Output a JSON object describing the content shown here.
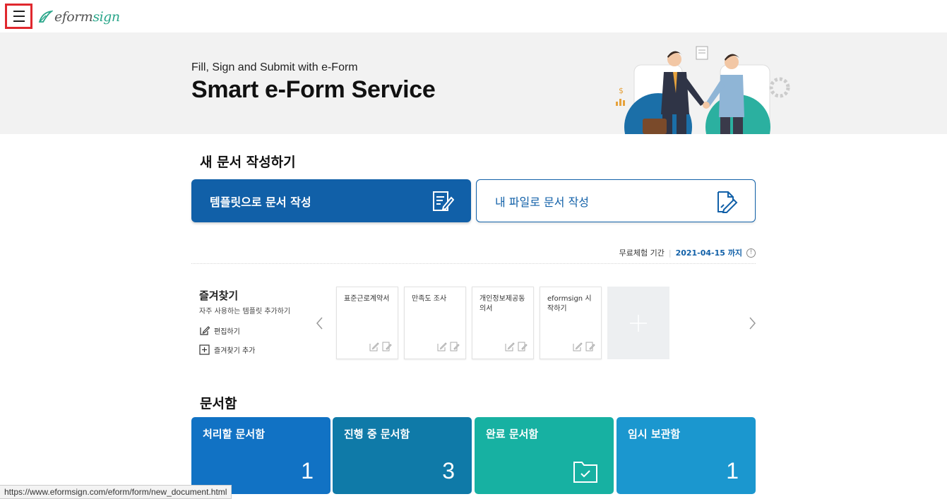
{
  "header": {
    "menu_icon": "hamburger-icon",
    "logo_part1": "e",
    "logo_part2": "form",
    "logo_part3": "sign"
  },
  "hero": {
    "subtitle": "Fill, Sign and Submit with e-Form",
    "title": "Smart e-Form Service"
  },
  "create": {
    "section_title": "새 문서 작성하기",
    "template_button": "템플릿으로 문서 작성",
    "file_button": "내 파일로 문서 작성"
  },
  "trial": {
    "label": "무료체험 기간",
    "date": "2021-04-15 까지"
  },
  "favorites": {
    "title": "즐겨찾기",
    "description": "자주 사용하는 템플릿 추가하기",
    "edit_label": "편집하기",
    "add_label": "즐겨찾기 추가",
    "cards": [
      {
        "title": "표준근로계약서"
      },
      {
        "title": "만족도 조사"
      },
      {
        "title": "개인정보제공동의서"
      },
      {
        "title": "eformsign 시작하기"
      }
    ]
  },
  "docbox": {
    "section_title": "문서함",
    "boxes": [
      {
        "label": "처리할 문서함",
        "count": "1",
        "color": "#1172c4"
      },
      {
        "label": "진행 중 문서함",
        "count": "3",
        "color": "#0f7aa8"
      },
      {
        "label": "완료 문서함",
        "count": "",
        "color": "#17b1a2"
      },
      {
        "label": "임시 보관함",
        "count": "1",
        "color": "#1b97cf"
      }
    ]
  },
  "status_bar": {
    "url": "https://www.eformsign.com/eform/form/new_document.html"
  }
}
